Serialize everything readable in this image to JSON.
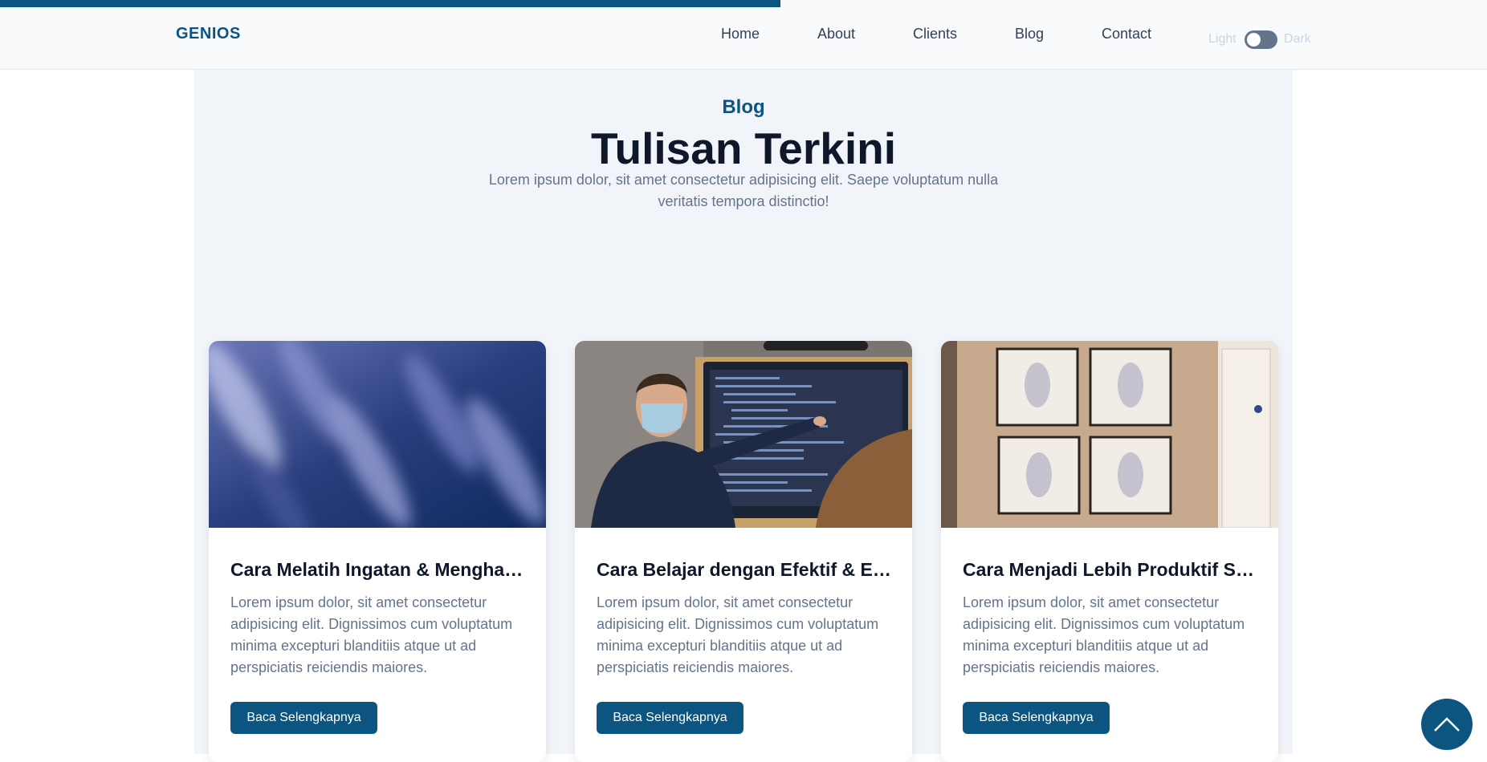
{
  "progress_fraction": 0.525,
  "navbar": {
    "brand": "GENIOS",
    "links": [
      "Home",
      "About",
      "Clients",
      "Blog",
      "Contact"
    ],
    "theme": {
      "light_label": "Light",
      "dark_label": "Dark"
    }
  },
  "blog": {
    "tag": "Blog",
    "title": "Tulisan Terkini",
    "description": "Lorem ipsum dolor, sit amet consectetur adipisicing elit. Saepe voluptatum nulla veritatis tempora distinctio!",
    "cards": [
      {
        "title": "Cara Melatih Ingatan & Menghafal dengan Cepat",
        "text": "Lorem ipsum dolor, sit amet consectetur adipisicing elit. Dignissimos cum voluptatum minima excepturi blanditiis atque ut ad perspiciatis reiciendis maiores.",
        "button": "Baca Selengkapnya"
      },
      {
        "title": "Cara Belajar dengan Efektif & Efisien",
        "text": "Lorem ipsum dolor, sit amet consectetur adipisicing elit. Dignissimos cum voluptatum minima excepturi blanditiis atque ut ad perspiciatis reiciendis maiores.",
        "button": "Baca Selengkapnya"
      },
      {
        "title": "Cara Menjadi Lebih Produktif Setiap Hari",
        "text": "Lorem ipsum dolor, sit amet consectetur adipisicing elit. Dignissimos cum voluptatum minima excepturi blanditiis atque ut ad perspiciatis reiciendis maiores.",
        "button": "Baca Selengkapnya"
      }
    ]
  },
  "colors": {
    "accent": "#0b5580",
    "section_bg": "#f1f5f9",
    "title": "#0f172a",
    "muted": "#64748b"
  },
  "icons": {
    "scroll_top": "chevron-up-icon"
  }
}
